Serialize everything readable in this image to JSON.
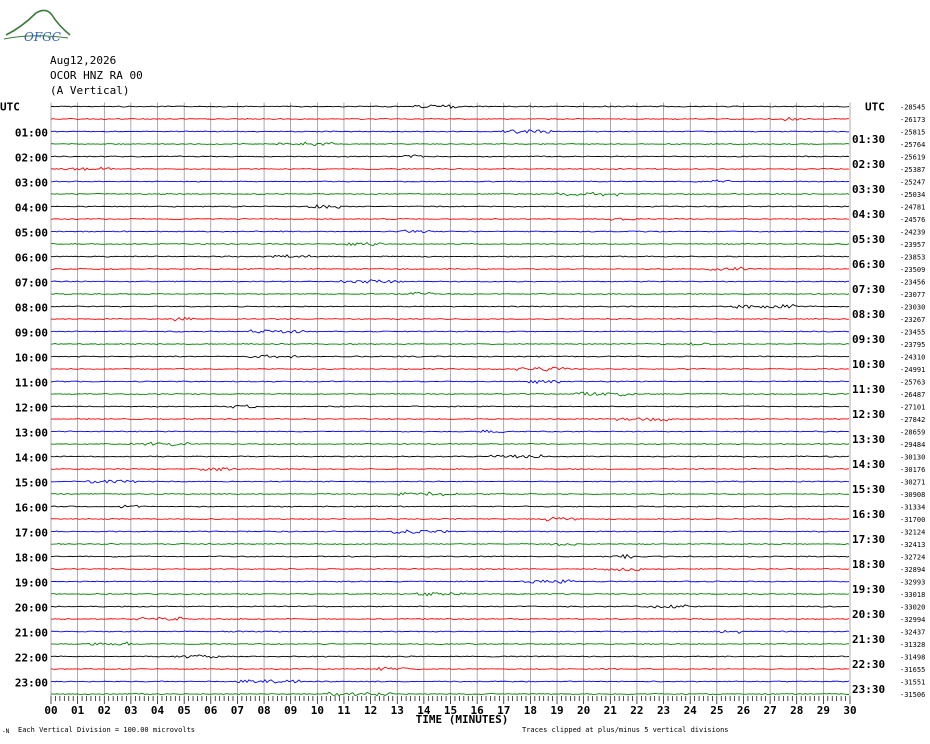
{
  "header": {
    "logo_text": "OFGC",
    "date": "Aug12,2026",
    "station": "OCOR HNZ RA 00",
    "component": "(A Vertical)"
  },
  "colors": {
    "trace_cycle": [
      "#000000",
      "#ff0000",
      "#0000ff",
      "#008000"
    ],
    "grid": "#000000",
    "logo": "#3b7a3b",
    "logo_text": "#2d5fb3"
  },
  "chart_data": {
    "type": "line",
    "left_axis_label": "UTC",
    "right_axis_label": "UTC",
    "left_hour_labels": [
      "01:00",
      "02:00",
      "03:00",
      "04:00",
      "05:00",
      "06:00",
      "07:00",
      "08:00",
      "09:00",
      "10:00",
      "11:00",
      "12:00",
      "13:00",
      "14:00",
      "15:00",
      "16:00",
      "17:00",
      "18:00",
      "19:00",
      "20:00",
      "21:00",
      "22:00",
      "23:00"
    ],
    "right_hour_labels": [
      "01:30",
      "02:30",
      "03:30",
      "04:30",
      "05:30",
      "06:30",
      "07:30",
      "08:30",
      "09:30",
      "10:30",
      "11:30",
      "12:30",
      "13:30",
      "14:30",
      "15:30",
      "16:30",
      "17:30",
      "18:30",
      "19:30",
      "20:30",
      "21:30",
      "22:30",
      "23:30"
    ],
    "x_tick_labels": [
      "00",
      "01",
      "02",
      "03",
      "04",
      "05",
      "06",
      "07",
      "08",
      "09",
      "10",
      "11",
      "12",
      "13",
      "14",
      "15",
      "16",
      "17",
      "18",
      "19",
      "20",
      "21",
      "22",
      "23",
      "24",
      "25",
      "26",
      "27",
      "28",
      "29",
      "30"
    ],
    "xlabel": "TIME (MINUTES)",
    "xlim": [
      0,
      30
    ],
    "trace_offsets": [
      "-28545",
      "-26173",
      "-25815",
      "-25764",
      "-25619",
      "-25387",
      "-25247",
      "-25034",
      "-24781",
      "-24576",
      "-24239",
      "-23957",
      "-23853",
      "-23509",
      "-23456",
      "-23077",
      "-23030",
      "-23267",
      "-23455",
      "-23795",
      "-24310",
      "-24991",
      "-25763",
      "-26487",
      "-27101",
      "-27842",
      "-28659",
      "-29484",
      "-30130",
      "-30176",
      "-30271",
      "-30908",
      "-31334",
      "-31700",
      "-32124",
      "-32413",
      "-32724",
      "-32894",
      "-32993",
      "-33018",
      "-33020",
      "-32994",
      "-32437",
      "-31328",
      "-31498",
      "-31655",
      "-31551",
      "-31506"
    ],
    "bottom_left_note": "Each Vertical Division = 100.00 microvolts",
    "bottom_right_note": "Traces clipped at plus/minus 5 vertical divisions",
    "corner_mark": "-N"
  }
}
